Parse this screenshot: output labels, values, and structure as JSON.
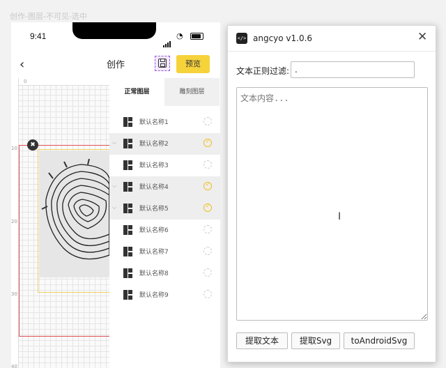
{
  "frame_label": "创作-图层-不可见-选中",
  "phone": {
    "time": "9:41",
    "wifi_icon": "wifi-icon",
    "back_icon": "chevron-left-icon",
    "title": "创作",
    "save_icon": "save-icon",
    "preview_label": "预览",
    "ruler": {
      "top": [
        "0"
      ],
      "left": [
        "10",
        "20",
        "30",
        "40"
      ]
    },
    "tabs": [
      "正常图层",
      "雕刻图层"
    ],
    "layers": [
      {
        "name": "默认名称1",
        "selected": false,
        "checked": false
      },
      {
        "name": "默认名称2",
        "selected": true,
        "checked": true
      },
      {
        "name": "默认名称3",
        "selected": false,
        "checked": false
      },
      {
        "name": "默认名称4",
        "selected": true,
        "checked": true
      },
      {
        "name": "默认名称5",
        "selected": true,
        "checked": true
      },
      {
        "name": "默认名称6",
        "selected": false,
        "checked": false
      },
      {
        "name": "默认名称7",
        "selected": false,
        "checked": false
      },
      {
        "name": "默认名称8",
        "selected": false,
        "checked": false
      },
      {
        "name": "默认名称9",
        "selected": false,
        "checked": false
      }
    ],
    "accent_color": "#f6d23b"
  },
  "dialog": {
    "title": "angcyo v1.0.6",
    "app_icon": "code-icon",
    "close_icon": "close-icon",
    "filter_label": "文本正则过滤:",
    "filter_value": ".",
    "content_placeholder": "文本内容...",
    "buttons": [
      "提取文本",
      "提取Svg",
      "toAndroidSvg"
    ]
  }
}
